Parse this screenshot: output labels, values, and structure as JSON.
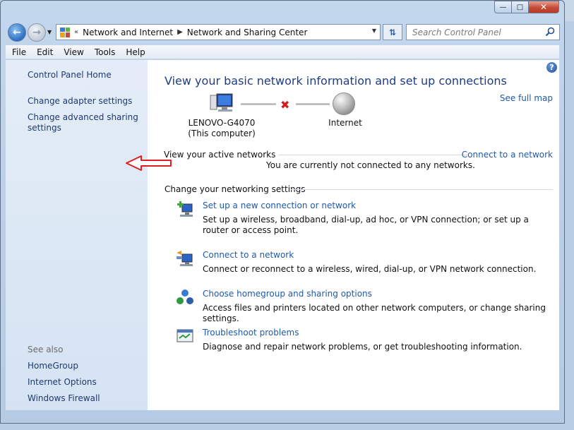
{
  "window": {
    "controls": {
      "minimize": "—",
      "maximize": "□",
      "close": "✕"
    }
  },
  "nav": {
    "breadcrumb": [
      "Network and Internet",
      "Network and Sharing Center"
    ],
    "search_placeholder": "Search Control Panel"
  },
  "menu": [
    "File",
    "Edit",
    "View",
    "Tools",
    "Help"
  ],
  "sidebar": {
    "home": "Control Panel Home",
    "adapter": "Change adapter settings",
    "advanced_line1": "Change advanced sharing",
    "advanced_line2": "settings",
    "see_also": "See also",
    "see_also_items": [
      "HomeGroup",
      "Internet Options",
      "Windows Firewall"
    ]
  },
  "main": {
    "title": "View your basic network information and set up connections",
    "see_full_map": "See full map",
    "computer_name": "LENOVO-G4070",
    "computer_sub": "(This computer)",
    "internet_label": "Internet",
    "active_networks_label": "View your active networks",
    "connect_link": "Connect to a network",
    "not_connected": "You are currently not connected to any networks.",
    "change_settings_label": "Change your networking settings",
    "tasks": [
      {
        "title": "Set up a new connection or network",
        "desc": "Set up a wireless, broadband, dial-up, ad hoc, or VPN connection; or set up a router or access point."
      },
      {
        "title": "Connect to a network",
        "desc": "Connect or reconnect to a wireless, wired, dial-up, or VPN network connection."
      },
      {
        "title": "Choose homegroup and sharing options",
        "desc": "Access files and printers located on other network computers, or change sharing settings."
      },
      {
        "title": "Troubleshoot problems",
        "desc": "Diagnose and repair network problems, or get troubleshooting information."
      }
    ]
  },
  "colors": {
    "link": "#1e5aa8",
    "title": "#1f3c8a",
    "annotation_arrow": "#e02020"
  }
}
